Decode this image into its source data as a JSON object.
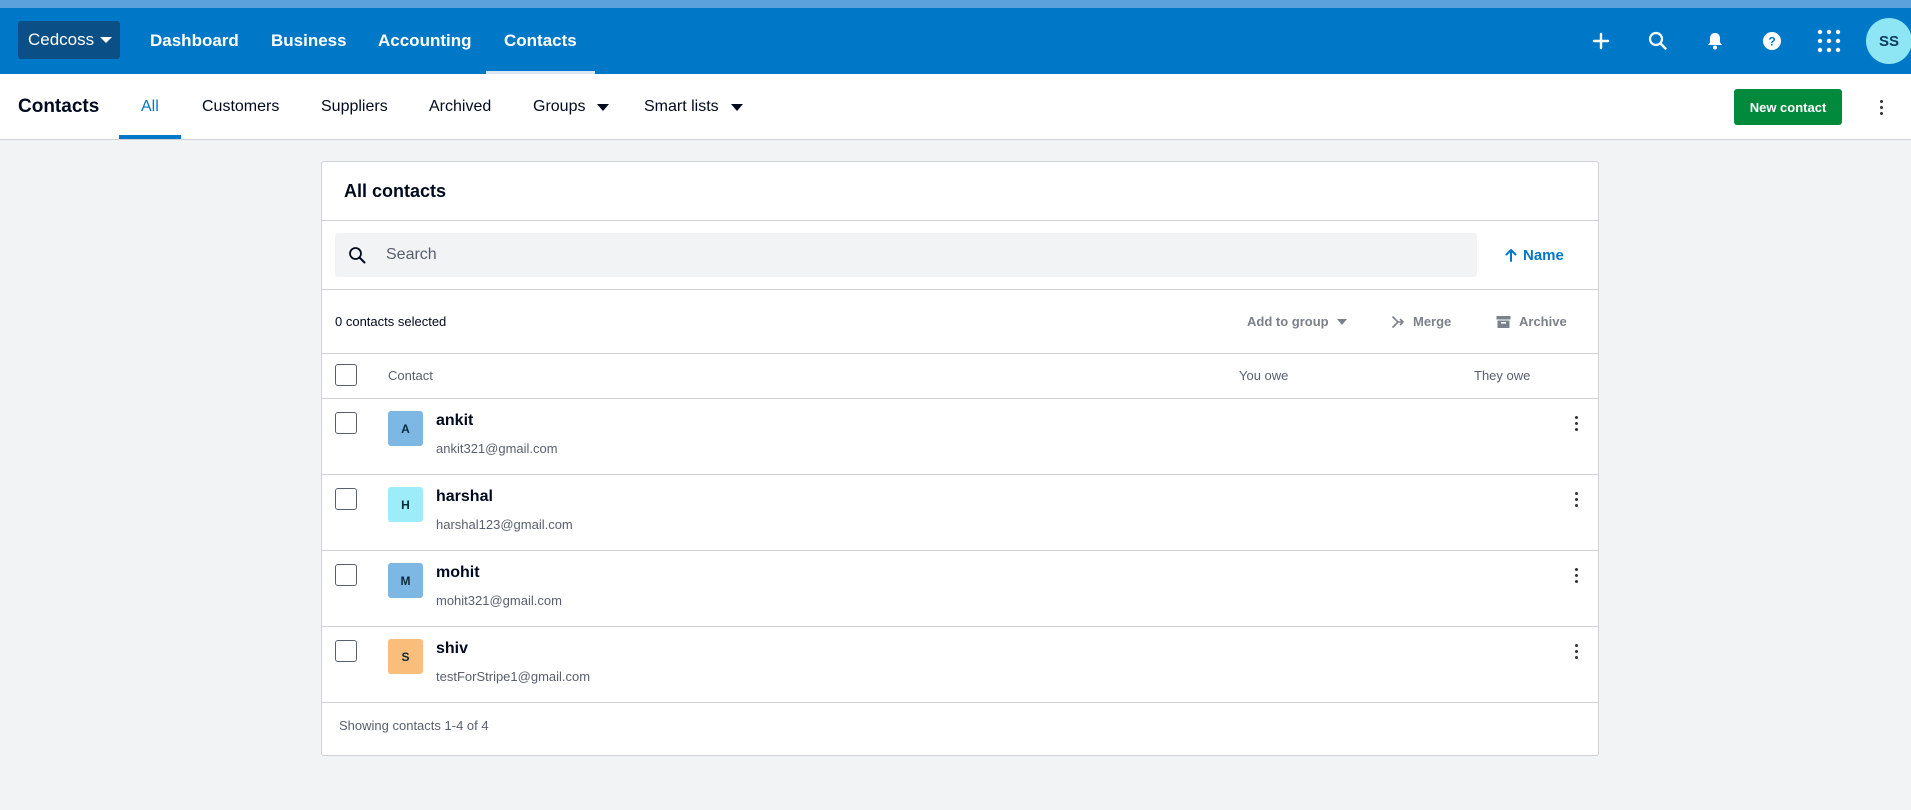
{
  "navbar": {
    "org_name": "Cedcoss",
    "links": [
      {
        "label": "Dashboard"
      },
      {
        "label": "Business"
      },
      {
        "label": "Accounting"
      },
      {
        "label": "Contacts"
      }
    ],
    "avatar_initials": "SS",
    "icons": [
      "plus-icon",
      "search-icon",
      "bell-icon",
      "help-icon",
      "apps-grid-icon"
    ],
    "color": "#0078c8"
  },
  "subnav": {
    "title": "Contacts",
    "tabs": [
      {
        "label": "All"
      },
      {
        "label": "Customers"
      },
      {
        "label": "Suppliers"
      },
      {
        "label": "Archived"
      },
      {
        "label": "Groups"
      },
      {
        "label": "Smart lists"
      }
    ],
    "active_tab": "All",
    "new_contact_label": "New contact",
    "new_contact_color": "#018a3c"
  },
  "panel": {
    "title": "All contacts",
    "search_placeholder": "Search",
    "sort_label": "Name",
    "selected_count": "0 contacts selected",
    "add_to_group_label": "Add to group",
    "merge_label": "Merge",
    "archive_label": "Archive",
    "columns": [
      "Contact",
      "You owe",
      "They owe"
    ],
    "contacts": [
      {
        "initial": "A",
        "name": "ankit",
        "email": "ankit321@gmail.com",
        "color": "#7db8e4"
      },
      {
        "initial": "H",
        "name": "harshal",
        "email": "harshal123@gmail.com",
        "color": "#9decf9"
      },
      {
        "initial": "M",
        "name": "mohit",
        "email": "mohit321@gmail.com",
        "color": "#7db8e4"
      },
      {
        "initial": "S",
        "name": "shiv",
        "email": "testForStripe1@gmail.com",
        "color": "#fbbd7a"
      }
    ],
    "footer": "Showing contacts 1-4 of 4"
  }
}
